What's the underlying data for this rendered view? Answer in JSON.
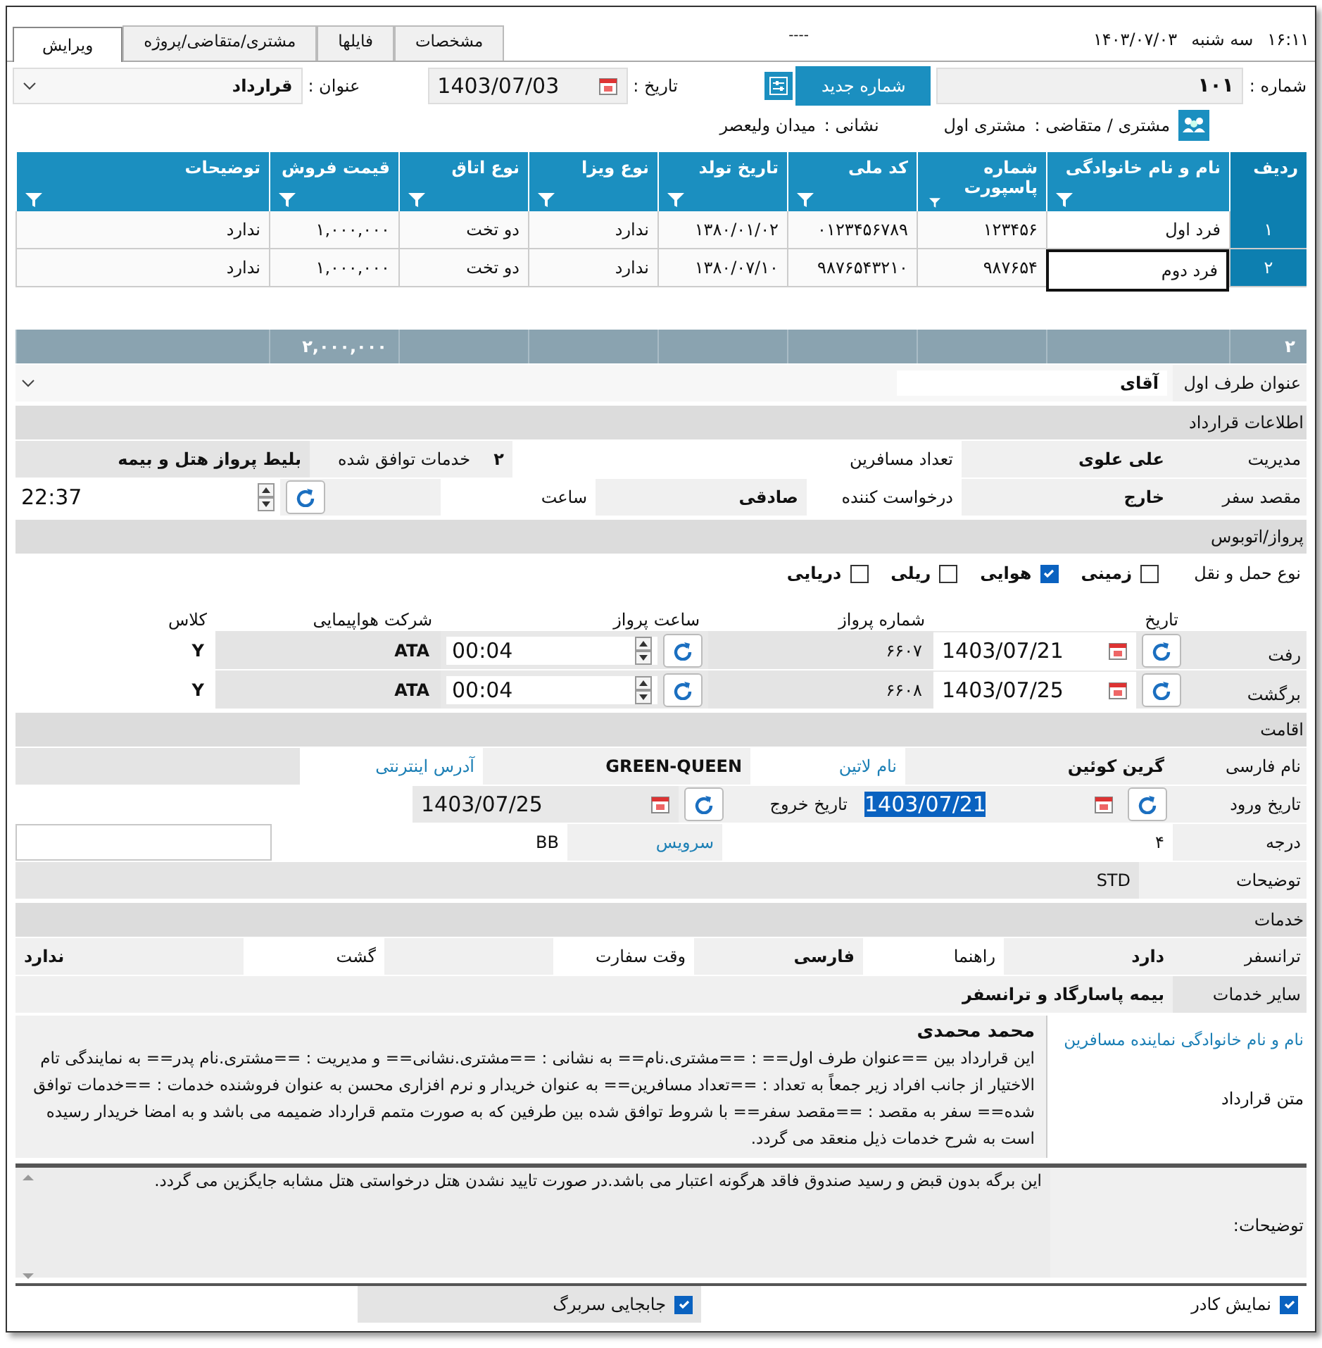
{
  "top_bar": {
    "clock": "۱۶:۱۱",
    "weekday": "سه شنبه",
    "date": "۱۴۰۳/۰۷/۰۳",
    "separator": "----"
  },
  "tabs": [
    {
      "label": "مشخصات",
      "selected": false
    },
    {
      "label": "فایلها",
      "selected": false
    },
    {
      "label": "مشتری/متقاضی/پروژه",
      "selected": false
    },
    {
      "label": "ویرایش",
      "selected": true
    }
  ],
  "header": {
    "number_label": "شماره :",
    "number": "۱۰۱",
    "new_number_button": "شماره جدید",
    "date_label": "تاریخ :",
    "date": "1403/07/03",
    "title_label": "عنوان :",
    "title": "قرارداد",
    "customer_label": "مشتری / متقاضی :",
    "customer": "مشتری اول",
    "address_label": "نشانی :",
    "address": "میدان ولیعصر"
  },
  "passengers": {
    "columns": [
      "ردیف",
      "نام و نام خانوادگی",
      "شماره پاسپورت",
      "کد ملی",
      "تاریخ تولد",
      "نوع ویزا",
      "نوع اتاق",
      "قیمت فروش",
      "توضیحات"
    ],
    "rows": [
      {
        "cells": [
          "۱",
          "فرد اول",
          "۱۲۳۴۵۶",
          "۰۱۲۳۴۵۶۷۸۹",
          "۱۳۸۰/۰۱/۰۲",
          "ندارد",
          "دو تخت",
          "۱,۰۰۰,۰۰۰",
          "ندارد"
        ],
        "focused": false
      },
      {
        "cells": [
          "۲",
          "فرد دوم",
          "۹۸۷۶۵۴",
          "۹۸۷۶۵۴۳۲۱۰",
          "۱۳۸۰/۰۷/۱۰",
          "ندارد",
          "دو تخت",
          "۱,۰۰۰,۰۰۰",
          "ندارد"
        ],
        "focused": true
      }
    ],
    "footer": {
      "count": "۲",
      "total_price": "۲,۰۰۰,۰۰۰"
    }
  },
  "first_party": {
    "label": "عنوان طرف اول",
    "value": "آقای"
  },
  "contract_info": {
    "title": "اطلاعات قرارداد",
    "manager_label": "مدیریت",
    "manager": "علی علوی",
    "passengers_label": "تعداد مسافرین",
    "passengers": "۲",
    "services_label": "خدمات توافق شده",
    "services": "بلیط پرواز هتل و بیمه",
    "destination_label": "مقصد سفر",
    "destination": "خارج",
    "requester_label": "درخواست کننده",
    "requester": "صادقی",
    "time_label": "ساعت",
    "time": "22:37"
  },
  "flights": {
    "title": "پرواز/اتوبوس",
    "transport_label": "نوع حمل و نقل",
    "transport": [
      {
        "label": "زمینی",
        "checked": false
      },
      {
        "label": "هوایی",
        "checked": true
      },
      {
        "label": "ریلی",
        "checked": false
      },
      {
        "label": "دریایی",
        "checked": false
      }
    ],
    "columns": [
      "تاریخ",
      "شماره پرواز",
      "ساعت پرواز",
      "شرکت هواپیمایی",
      "کلاس"
    ],
    "legs": [
      {
        "label": "رفت",
        "date": "1403/07/21",
        "flight_no": "۶۶۰۷",
        "time": "00:04",
        "airline": "ATA",
        "class": "Y"
      },
      {
        "label": "برگشت",
        "date": "1403/07/25",
        "flight_no": "۶۶۰۸",
        "time": "00:04",
        "airline": "ATA",
        "class": "Y"
      }
    ]
  },
  "hotel": {
    "title": "اقامت",
    "persian_name_label": "نام فارسی",
    "persian_name": "گرین کوئین",
    "latin_name_label": "نام لاتین",
    "latin_name": "GREEN-QUEEN",
    "website_label": "آدرس اینترنتی",
    "check_in_label": "تاریخ ورود",
    "check_in": "1403/07/21",
    "check_in_selected": true,
    "check_out_label": "تاریخ خروج",
    "check_out": "1403/07/25",
    "grade_label": "درجه",
    "grade": "۴",
    "service_label": "سرویس",
    "service": "BB",
    "notes_label": "توضیحات",
    "notes": "STD"
  },
  "services": {
    "title": "خدمات",
    "items": [
      {
        "label": "ترانسفر",
        "value": "دارد"
      },
      {
        "label": "راهنما",
        "value": "فارسی"
      },
      {
        "label": "وقت سفارت"
      },
      {
        "label": "گشت",
        "value": "ندارد"
      }
    ],
    "other_label": "سایر خدمات",
    "other": "بیمه پاسارگاد و ترانسفر"
  },
  "contract": {
    "representative_label": "نام و نام خانوادگی نماینده مسافرین",
    "representative": "محمد محمدی",
    "text_label": "متن قرارداد",
    "text": "این قرارداد بین ==عنوان طرف اول== : ==مشتری.نام==  به نشانی : ==مشتری.نشانی==  و مدیریت : ==مشتری.نام پدر==  به نمایندگی تام الاختیار از جانب افراد زیر جمعاً به تعداد : ==تعداد مسافرین== به عنوان خریدار و نرم افزاری محسن  به عنوان فروشنده خدمات : ==خدمات توافق شده==   سفر به مقصد : ==مقصد سفر== با شروط توافق شده بین طرفین که به صورت متمم قرارداد ضمیمه می باشد و به امضا خریدار رسیده است به شرح خدمات ذیل منعقد می گردد."
  },
  "notes": {
    "label": "توضیحات:",
    "text": "این برگه بدون قبض و رسید صندوق فاقد هرگونه اعتبار می باشد.در صورت تایید نشدن هتل درخواستی هتل مشابه جایگزین می گردد."
  },
  "options": [
    {
      "label": "نمایش کادر",
      "checked": true
    },
    {
      "label": "جابجایی سربرگ",
      "checked": true
    }
  ]
}
